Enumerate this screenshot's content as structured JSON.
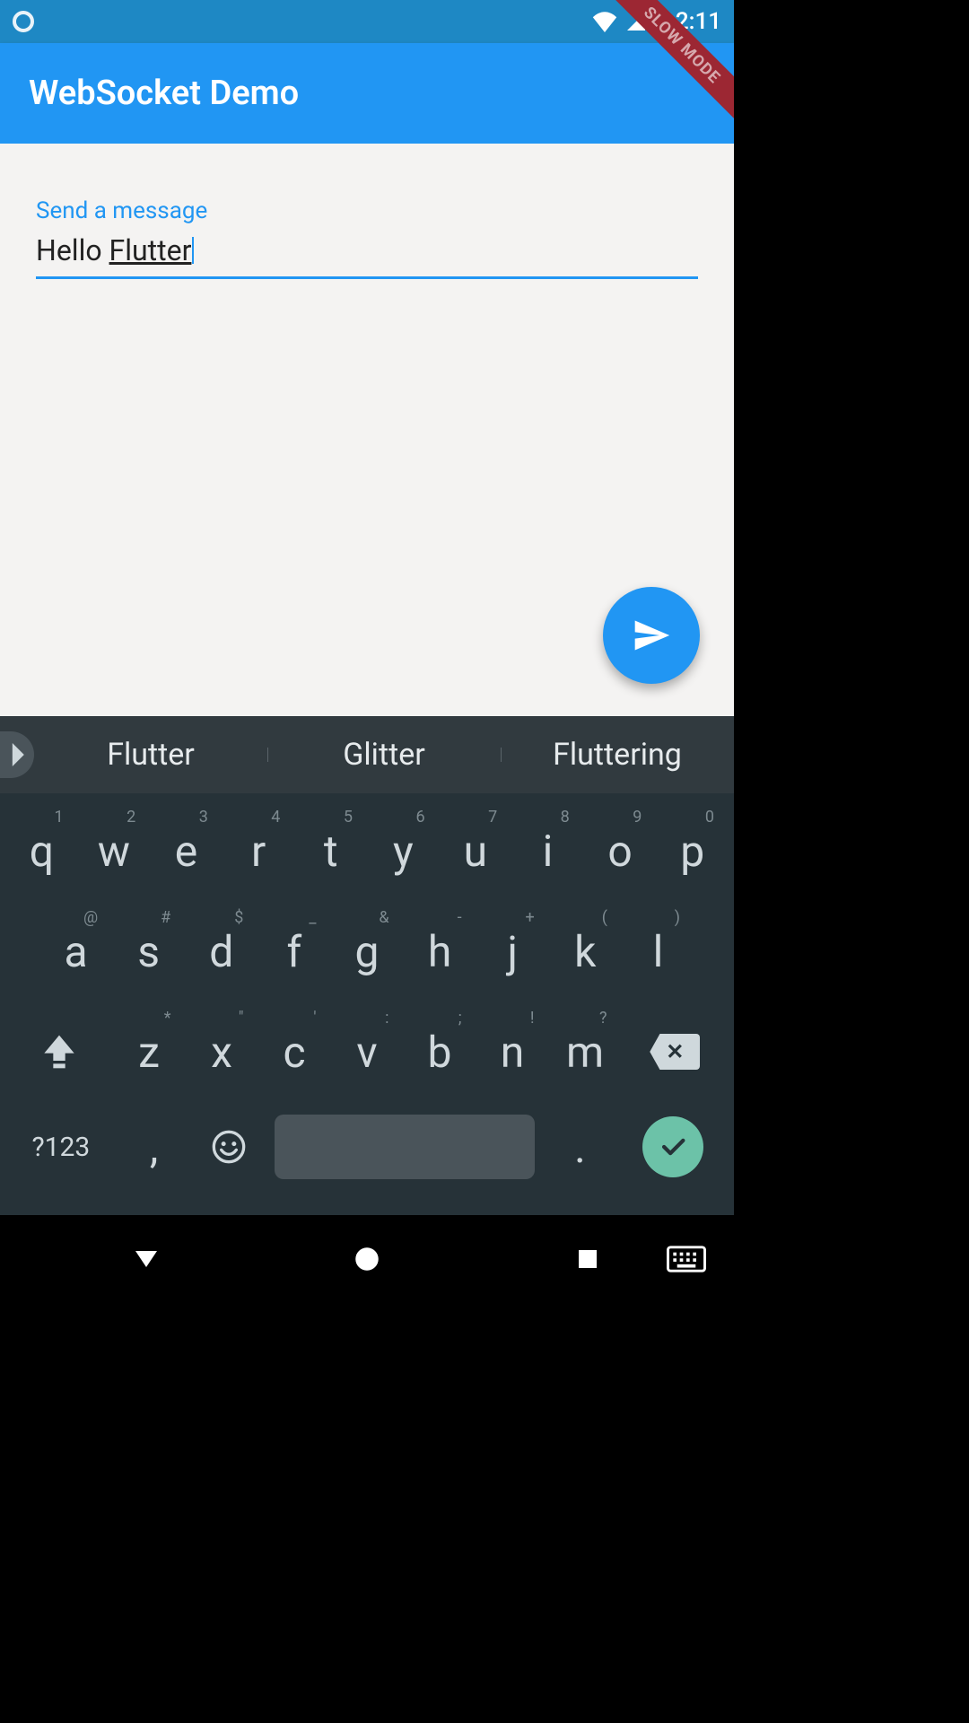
{
  "statusbar": {
    "time": "2:11"
  },
  "ribbon": {
    "label": "SLOW MODE"
  },
  "appbar": {
    "title": "WebSocket Demo"
  },
  "field": {
    "label": "Send a message",
    "value_plain": "Hello ",
    "value_underlined": "Flutter"
  },
  "suggestions": {
    "items": [
      "Flutter",
      "Glitter",
      "Fluttering"
    ]
  },
  "keyboard": {
    "row1": [
      {
        "k": "q",
        "h": "1"
      },
      {
        "k": "w",
        "h": "2"
      },
      {
        "k": "e",
        "h": "3"
      },
      {
        "k": "r",
        "h": "4"
      },
      {
        "k": "t",
        "h": "5"
      },
      {
        "k": "y",
        "h": "6"
      },
      {
        "k": "u",
        "h": "7"
      },
      {
        "k": "i",
        "h": "8"
      },
      {
        "k": "o",
        "h": "9"
      },
      {
        "k": "p",
        "h": "0"
      }
    ],
    "row2": [
      {
        "k": "a",
        "h": "@"
      },
      {
        "k": "s",
        "h": "#"
      },
      {
        "k": "d",
        "h": "$"
      },
      {
        "k": "f",
        "h": "_"
      },
      {
        "k": "g",
        "h": "&"
      },
      {
        "k": "h",
        "h": "-"
      },
      {
        "k": "j",
        "h": "+"
      },
      {
        "k": "k",
        "h": "("
      },
      {
        "k": "l",
        "h": ")"
      }
    ],
    "row3": [
      {
        "k": "z",
        "h": "*"
      },
      {
        "k": "c",
        "h": "'"
      },
      {
        "k": "x",
        "h": "\""
      },
      {
        "k": "v",
        "h": ":"
      },
      {
        "k": "b",
        "h": ";"
      },
      {
        "k": "n",
        "h": "!"
      },
      {
        "k": "m",
        "h": "?"
      }
    ],
    "sym_label": "?123",
    "comma": ",",
    "period": "."
  }
}
